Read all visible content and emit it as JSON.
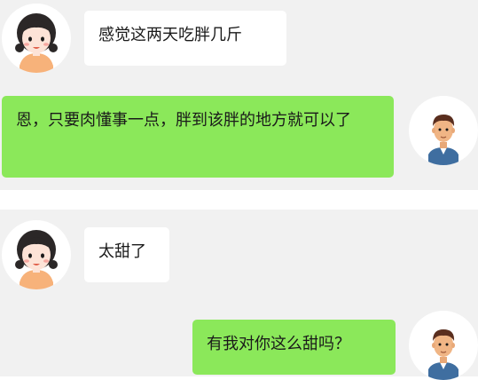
{
  "colors": {
    "background": "#f1f1f1",
    "incoming_bubble": "#ffffff",
    "outgoing_bubble": "#8be85a",
    "text": "#1a1a1a"
  },
  "messages": [
    {
      "sender": "female",
      "side": "left",
      "avatar": "girl-avatar-icon",
      "text": "感觉这两天吃胖几斤"
    },
    {
      "sender": "male",
      "side": "right",
      "avatar": "boy-avatar-icon",
      "text": "恩，只要肉懂事一点，胖到该胖的地方就可以了"
    },
    {
      "sender": "female",
      "side": "left",
      "avatar": "girl-avatar-icon",
      "text": "太甜了"
    },
    {
      "sender": "male",
      "side": "right",
      "avatar": "boy-avatar-icon",
      "text": "有我对你这么甜吗？"
    }
  ]
}
